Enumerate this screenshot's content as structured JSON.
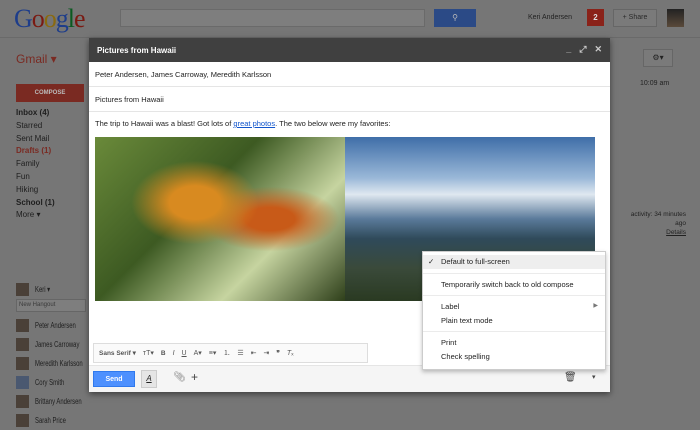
{
  "header": {
    "logo": "Google",
    "user": "Keri Andersen",
    "notifications": "2",
    "share": "+ Share"
  },
  "sidebar": {
    "app": "Gmail ▾",
    "compose": "COMPOSE",
    "items": [
      "Inbox (4)",
      "Starred",
      "Sent Mail",
      "Drafts (1)",
      "Family",
      "Fun",
      "Hiking",
      "School (1)",
      "More ▾"
    ],
    "me": "Keri ▾",
    "hangout_placeholder": "New Hangout",
    "contacts": [
      "Peter Andersen",
      "James Carroway",
      "Meredith Karlsson",
      "Cory Smith",
      "Brittany Andersen",
      "Sarah Price"
    ]
  },
  "background": {
    "time": "10:09 am",
    "activity": "activity: 34 minutes ago",
    "details": "Details"
  },
  "compose": {
    "title": "Pictures from Hawaii",
    "to": "Peter Andersen, James Carroway, Meredith Karlsson",
    "subject": "Pictures from Hawaii",
    "body_start": "The trip to Hawaii was a blast!  Got lots of ",
    "link": "great photos",
    "body_end": ".  The two below were my favorites:",
    "font": "Sans Serif ▾",
    "send": "Send"
  },
  "menu": {
    "items": [
      "Default to full-screen",
      "Temporarily switch back to old compose",
      "Label",
      "Plain text mode",
      "Print",
      "Check spelling"
    ]
  },
  "colors": {
    "accent": "#4d90fe",
    "gmail_red": "#d14836",
    "titlebar": "#404040"
  }
}
